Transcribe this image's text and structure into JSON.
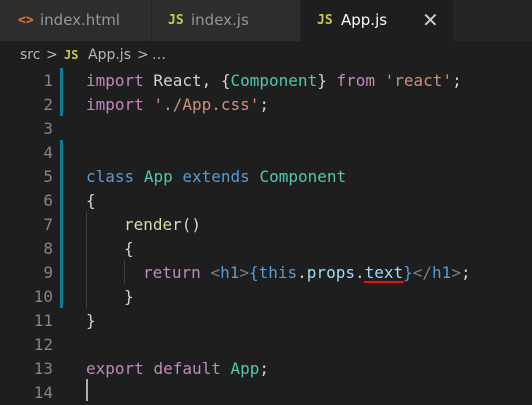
{
  "tabs": [
    {
      "icon": "<>",
      "label": "index.html",
      "active": false
    },
    {
      "icon": "JS",
      "label": "index.js",
      "active": false
    },
    {
      "icon": "JS",
      "label": "App.js",
      "active": true,
      "close": "✕"
    }
  ],
  "breadcrumb": {
    "root": "src",
    "sep": ">",
    "file_icon": "JS",
    "file": "App.js",
    "ellipsis": "…"
  },
  "editor": {
    "line_numbers": [
      "1",
      "2",
      "3",
      "4",
      "5",
      "6",
      "7",
      "8",
      "9",
      "10",
      "11",
      "12",
      "13",
      "14"
    ],
    "lines": [
      [
        "import",
        " React, {",
        "Component",
        "} ",
        "from",
        " ",
        "'react'",
        ";"
      ],
      [
        "import",
        " ",
        "'./App.css'",
        ";"
      ],
      [],
      [],
      [
        "class",
        " ",
        "App",
        " ",
        "extends",
        " ",
        "Component"
      ],
      [
        "{"
      ],
      [
        "render",
        "()"
      ],
      [
        "{"
      ],
      [
        "return",
        " ",
        "<",
        "h1",
        ">",
        "{",
        "this",
        ".",
        "props",
        ".",
        "text",
        "}",
        "</",
        "h1",
        ">",
        ";"
      ],
      [
        "}"
      ],
      [
        "}"
      ],
      [],
      [
        "export",
        " ",
        "default",
        " ",
        "App",
        ";"
      ],
      []
    ]
  },
  "colors": {
    "keyword": "#569cd6",
    "control": "#c586c0",
    "string": "#ce9178",
    "class": "#4ec9b0",
    "function": "#dcdcaa",
    "variable": "#9cdcfe",
    "error": "#e51400"
  }
}
